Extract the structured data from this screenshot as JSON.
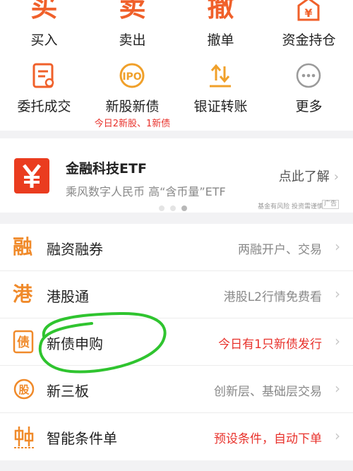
{
  "quick_actions": [
    {
      "icon": "buy-icon",
      "glyph": "买",
      "label": "买入"
    },
    {
      "icon": "sell-icon",
      "glyph": "卖",
      "label": "卖出"
    },
    {
      "icon": "cancel-order-icon",
      "glyph": "撤",
      "label": "撤单"
    },
    {
      "icon": "funds-holdings-icon",
      "glyph": "¥",
      "label": "资金持仓"
    },
    {
      "icon": "orders-icon",
      "label": "委托成交"
    },
    {
      "icon": "ipo-icon",
      "label": "新股新债",
      "sub": "今日2新股、1新债"
    },
    {
      "icon": "bank-transfer-icon",
      "label": "银证转账"
    },
    {
      "icon": "more-icon",
      "label": "更多"
    }
  ],
  "banner": {
    "title": "金融科技ETF",
    "subtitle": "乘风数字人民币  高“含币量”ETF",
    "cta": "点此了解",
    "disclaimer": "基金有风险 投资需谨慎",
    "ad_label": "广告",
    "active_dot": 2
  },
  "menu": [
    {
      "icon": "margin-trading-icon",
      "glyph": "融",
      "label": "融资融券",
      "desc": "两融开户、交易",
      "desc_highlight": false
    },
    {
      "icon": "hk-connect-icon",
      "glyph": "港",
      "label": "港股通",
      "desc": "港股L2行情免费看",
      "desc_highlight": false
    },
    {
      "icon": "bond-subscription-icon",
      "glyph": "债",
      "label": "新债申购",
      "desc": "今日有1只新债发行",
      "desc_highlight": true
    },
    {
      "icon": "neeq-icon",
      "glyph": "股",
      "label": "新三板",
      "desc": "创新层、基础层交易",
      "desc_highlight": false
    },
    {
      "icon": "smart-order-icon",
      "glyph": "≎",
      "label": "智能条件单",
      "desc": "预设条件，自动下单",
      "desc_highlight": true
    }
  ],
  "colors": {
    "accent": "#f0602a",
    "highlight": "#e8312b",
    "annotation": "#2fc42f"
  }
}
